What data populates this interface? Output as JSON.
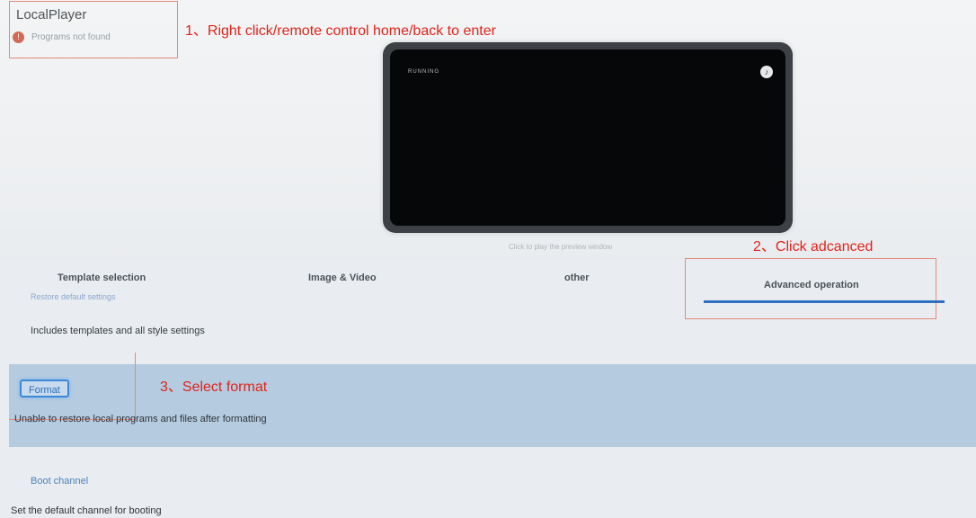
{
  "app": {
    "title": "LocalPlayer",
    "error_text": "Programs not found"
  },
  "annotations": {
    "step1": "1、Right click/remote control home/back to enter",
    "step2": "2、Click adcanced",
    "step3": "3、Select format"
  },
  "preview": {
    "screen_text": "RUNNING",
    "hint": "Click to play the preview window"
  },
  "tabs": [
    {
      "label": "Template selection"
    },
    {
      "label": "Image & Video"
    },
    {
      "label": "other"
    },
    {
      "label": "Advanced operation"
    }
  ],
  "settings": {
    "restore_title": "Restore default settings",
    "restore_desc": "Includes templates and all style settings",
    "format_label": "Format",
    "format_desc": "Unable to restore local programs and files after formatting",
    "boot_title": "Boot channel",
    "boot_desc": "Set the default channel for booting"
  },
  "colors": {
    "annotation": "#e2231a",
    "accent": "#2f6fc0",
    "selected_row": "#b5cbe0"
  }
}
